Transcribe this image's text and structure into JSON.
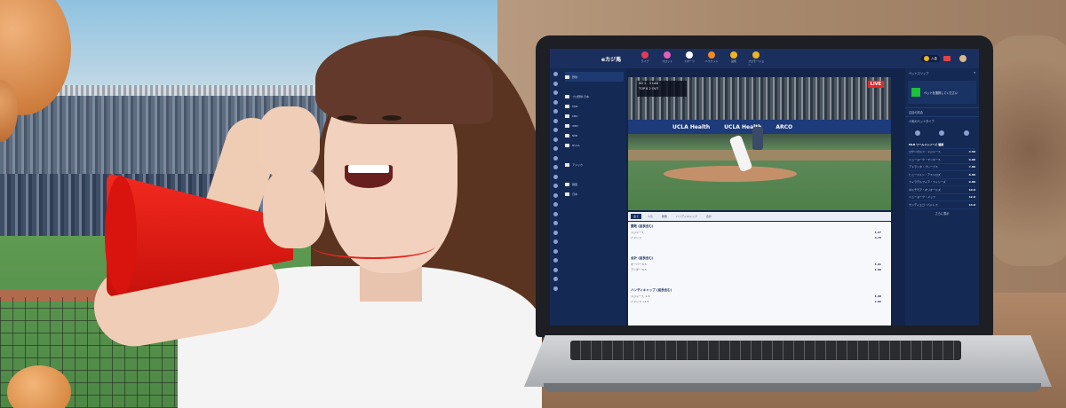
{
  "site": {
    "logo": "eカジ馬",
    "nav_items": [
      {
        "label": "ライブ",
        "color": "#e23b5a"
      },
      {
        "label": "スロット",
        "color": "#e45fb8"
      },
      {
        "label": "スポーツ",
        "color": "#ffffff"
      },
      {
        "label": "バスケット",
        "color": "#f08a24"
      },
      {
        "label": "競馬",
        "color": "#f0b320"
      },
      {
        "label": "プロモーション",
        "color": "#f0b320"
      }
    ],
    "balance": "入金",
    "accent_color": "#1a2f5e"
  },
  "left_sidebar": {
    "rows": [
      "野球",
      "",
      "プロ野球 日本",
      "MLB",
      "KBO",
      "WBC",
      "NPB",
      "NCAA",
      "",
      "アメリカ",
      "",
      "韓国",
      "日本"
    ]
  },
  "video": {
    "live_label": "LIVE",
    "banner": [
      "UCLA Health",
      "UCLA Health",
      "ARCO"
    ],
    "score_line1": "SD  1 - 3  LAD",
    "score_line2": "TOP 8  2 OUT"
  },
  "tabs": [
    "全て",
    "人気",
    "勝敗",
    "ハンディキャップ",
    "合計"
  ],
  "markets": [
    {
      "title": "勝敗 (延長含む)",
      "rows": [
        [
          "ドジャース",
          "1.27"
        ],
        [
          "パドレス",
          "3.75"
        ]
      ]
    },
    {
      "title": "合計 (延長含む)",
      "rows": [
        [
          "オーバー 6.5",
          "1.91"
        ],
        [
          "アンダー 6.5",
          "1.89"
        ]
      ]
    },
    {
      "title": "ハンディキャップ (延長含む)",
      "rows": [
        [
          "ドジャース -1.5",
          "1.98"
        ],
        [
          "パドレス +1.5",
          "1.82"
        ]
      ]
    }
  ],
  "right_sidebar": {
    "header": "ベットスリップ",
    "card_text": "ベットを選択してください",
    "sections": [
      "注目の試合",
      "人気のベットタイプ"
    ],
    "list_title": "MLB ワールドシリーズ 優勝",
    "list": [
      [
        "ロサンゼルス・ドジャース",
        "4.50"
      ],
      [
        "ニューヨーク・ヤンキース",
        "6.00"
      ],
      [
        "アトランタ・ブレーブス",
        "7.00"
      ],
      [
        "ヒューストン・アストロズ",
        "8.00"
      ],
      [
        "フィラデルフィア・フィリーズ",
        "9.00"
      ],
      [
        "ボルチモア・オリオールズ",
        "10.0"
      ],
      [
        "ニューヨーク・メッツ",
        "12.0"
      ],
      [
        "サンディエゴ・パドレス",
        "14.0"
      ]
    ],
    "more_label": "さらに表示"
  }
}
